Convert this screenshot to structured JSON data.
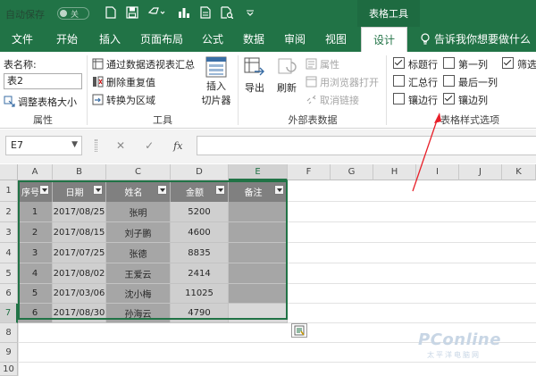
{
  "titlebar": {
    "autosave_label": "自动保存",
    "autosave_state": "关",
    "context_group": "表格工具"
  },
  "tabs": [
    "文件",
    "开始",
    "插入",
    "页面布局",
    "公式",
    "数据",
    "审阅",
    "视图",
    "设计"
  ],
  "active_tab": "设计",
  "tell_me": "告诉我你想要做什么",
  "ribbon": {
    "properties": {
      "table_name_label": "表名称:",
      "table_name_value": "表2",
      "resize_label": "调整表格大小",
      "group_label": "属性"
    },
    "tools": {
      "pivot": "通过数据透视表汇总",
      "remove_duplicates": "删除重复值",
      "convert_to_range": "转换为区域",
      "slicer_line1": "插入",
      "slicer_line2": "切片器",
      "group_label": "工具"
    },
    "external": {
      "export": "导出",
      "refresh": "刷新",
      "properties": "属性",
      "open_in_browser": "用浏览器打开",
      "unlink": "取消链接",
      "group_label": "外部表数据"
    },
    "style_options": {
      "header_row": {
        "label": "标题行",
        "checked": true
      },
      "total_row": {
        "label": "汇总行",
        "checked": false
      },
      "banded_rows": {
        "label": "镶边行",
        "checked": false
      },
      "first_column": {
        "label": "第一列",
        "checked": false
      },
      "last_column": {
        "label": "最后一列",
        "checked": false
      },
      "banded_columns": {
        "label": "镶边列",
        "checked": true
      },
      "filter_button": {
        "label": "筛选",
        "checked": true
      },
      "group_label": "表格样式选项"
    }
  },
  "formula_bar": {
    "name_box": "E7",
    "fx": "fx",
    "cancel": "✕",
    "enter": "✓",
    "value": ""
  },
  "grid": {
    "columns": [
      "A",
      "B",
      "C",
      "D",
      "E",
      "F",
      "G",
      "H",
      "I",
      "J",
      "K"
    ],
    "rows": [
      "1",
      "2",
      "3",
      "4",
      "5",
      "6",
      "7",
      "8",
      "9",
      "10"
    ],
    "selected_column": "E",
    "selected_row": "7"
  },
  "table": {
    "headers": [
      "序号",
      "日期",
      "姓名",
      "金额",
      "备注"
    ],
    "rows": [
      [
        "1",
        "2017/08/25",
        "张明",
        "5200",
        ""
      ],
      [
        "2",
        "2017/08/15",
        "刘子鹏",
        "4600",
        ""
      ],
      [
        "3",
        "2017/07/25",
        "张德",
        "8835",
        ""
      ],
      [
        "4",
        "2017/08/02",
        "王爱云",
        "2414",
        ""
      ],
      [
        "5",
        "2017/03/06",
        "沈小梅",
        "11025",
        ""
      ],
      [
        "6",
        "2017/08/30",
        "孙海云",
        "4790",
        ""
      ]
    ]
  },
  "colors": {
    "excel_green": "#217346",
    "annotation_arrow": "#e8202a",
    "table_header": "#808080",
    "band_dark": "#a6a6a6",
    "band_light": "#cfcfcf"
  },
  "watermark": {
    "brand": "PConline",
    "sub": "太平洋电脑网"
  }
}
